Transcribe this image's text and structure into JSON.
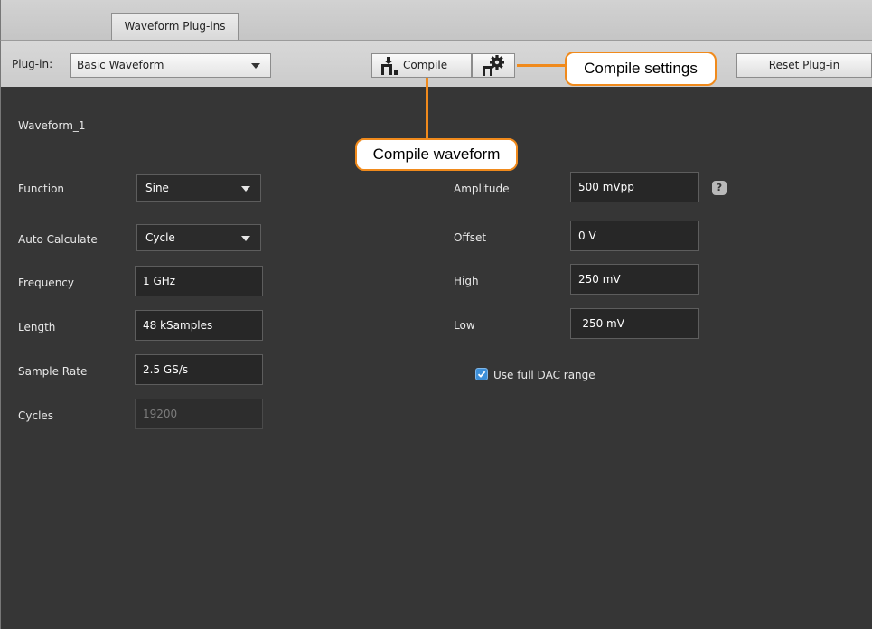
{
  "tabstrip": {
    "active_tab": "Waveform Plug-ins"
  },
  "plugin_bar": {
    "plugin_label": "Plug-in:",
    "plugin_value": "Basic Waveform",
    "compile_label": "Compile",
    "reset_label": "Reset Plug-in"
  },
  "callouts": {
    "settings": "Compile settings",
    "compile": "Compile waveform"
  },
  "panel": {
    "waveform_name": "Waveform_1",
    "left_fields": {
      "function": {
        "label": "Function",
        "value": "Sine"
      },
      "auto_calculate": {
        "label": "Auto Calculate",
        "value": "Cycle"
      },
      "frequency": {
        "label": "Frequency",
        "value": "1 GHz"
      },
      "length": {
        "label": "Length",
        "value": "48 kSamples"
      },
      "sample_rate": {
        "label": "Sample Rate",
        "value": "2.5 GS/s"
      },
      "cycles": {
        "label": "Cycles",
        "value": "19200"
      }
    },
    "right_fields": {
      "amplitude": {
        "label": "Amplitude",
        "value": "500 mVpp"
      },
      "offset": {
        "label": "Offset",
        "value": "0 V"
      },
      "high": {
        "label": "High",
        "value": "250 mV"
      },
      "low": {
        "label": "Low",
        "value": "-250 mV"
      }
    },
    "help_glyph": "?",
    "dac_range": {
      "label": "Use full DAC range",
      "checked": true
    }
  },
  "colors": {
    "panel_bg": "#363636",
    "callout_orange": "#f08a1c",
    "checkbox_blue": "#3d8fd8"
  }
}
